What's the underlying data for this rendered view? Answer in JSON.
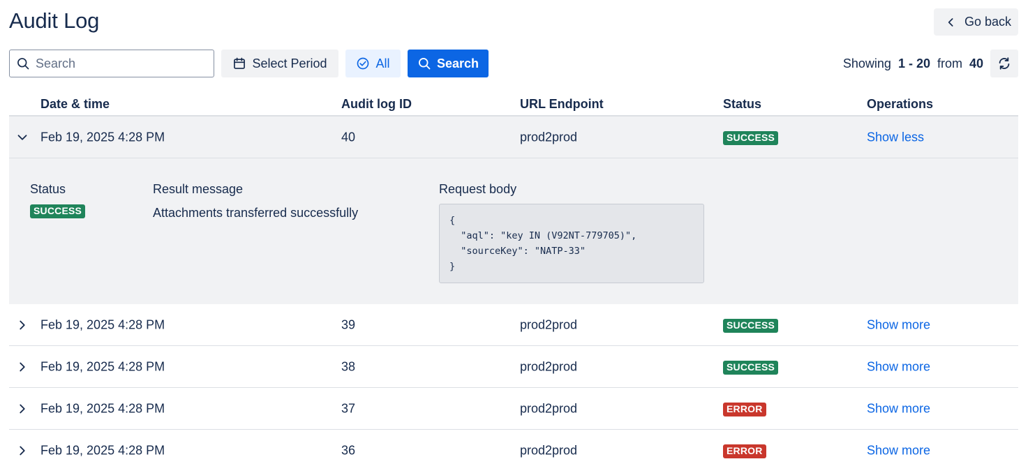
{
  "page": {
    "title": "Audit Log",
    "go_back_label": "Go back"
  },
  "toolbar": {
    "search_placeholder": "Search",
    "search_value": "",
    "select_period_label": "Select Period",
    "filter_all_label": "All",
    "search_button_label": "Search"
  },
  "pagination": {
    "showing_label": "Showing",
    "range": "1 - 20",
    "from_label": "from",
    "total": "40"
  },
  "table": {
    "columns": [
      "Date & time",
      "Audit log ID",
      "URL Endpoint",
      "Status",
      "Operations"
    ],
    "rows": [
      {
        "date": "Feb 19, 2025 4:28 PM",
        "id": "40",
        "endpoint": "prod2prod",
        "status": "SUCCESS",
        "operation": "Show less",
        "expanded": true
      },
      {
        "date": "Feb 19, 2025 4:28 PM",
        "id": "39",
        "endpoint": "prod2prod",
        "status": "SUCCESS",
        "operation": "Show more",
        "expanded": false
      },
      {
        "date": "Feb 19, 2025 4:28 PM",
        "id": "38",
        "endpoint": "prod2prod",
        "status": "SUCCESS",
        "operation": "Show more",
        "expanded": false
      },
      {
        "date": "Feb 19, 2025 4:28 PM",
        "id": "37",
        "endpoint": "prod2prod",
        "status": "ERROR",
        "operation": "Show more",
        "expanded": false
      },
      {
        "date": "Feb 19, 2025 4:28 PM",
        "id": "36",
        "endpoint": "prod2prod",
        "status": "ERROR",
        "operation": "Show more",
        "expanded": false
      }
    ]
  },
  "detail": {
    "status_label": "Status",
    "status_value": "SUCCESS",
    "result_label": "Result message",
    "result_value": "Attachments transferred successfully",
    "request_label": "Request body",
    "request_body": "{\n  \"aql\": \"key IN (V92NT-779705)\",\n  \"sourceKey\": \"NATP-33\"\n}"
  },
  "colors": {
    "primary": "#0c66e4",
    "success": "#1f845a",
    "error": "#c9372c",
    "neutral_bg": "#f1f2f4"
  },
  "icons": {
    "search": "search-icon",
    "calendar": "calendar-icon",
    "check": "check-circle-icon",
    "refresh": "refresh-icon",
    "back": "chevron-left-icon",
    "expand": "chevron-right-icon",
    "collapse": "chevron-down-icon"
  }
}
